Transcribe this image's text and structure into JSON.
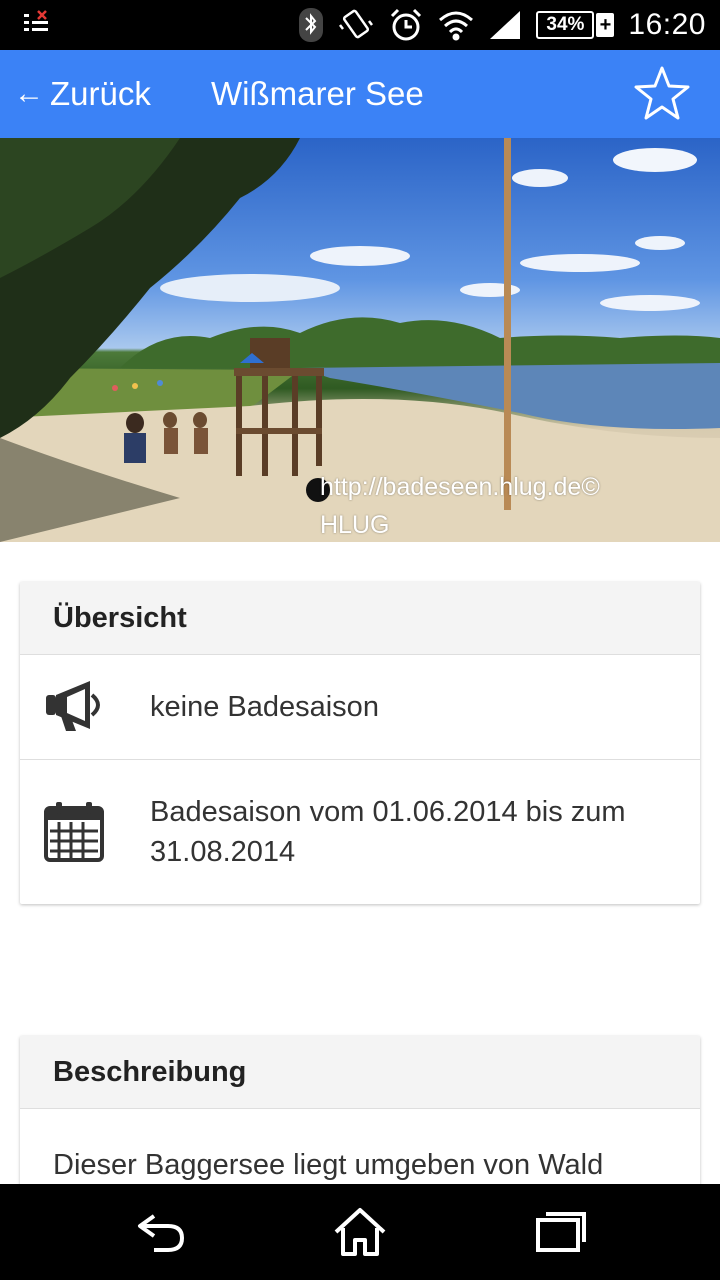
{
  "status_bar": {
    "battery_percent": "34%",
    "battery_plus": "+",
    "time": "16:20"
  },
  "app_bar": {
    "back_label": "Zurück",
    "title": "Wißmarer See",
    "accent_color": "#3b82f6"
  },
  "hero": {
    "caption": "http://badeseen.hlug.de© HLUG"
  },
  "overview": {
    "header": "Übersicht",
    "rows": [
      {
        "icon": "megaphone-icon",
        "text": "keine Badesaison"
      },
      {
        "icon": "calendar-icon",
        "text": "Badesaison vom 01.06.2014 bis zum 31.08.2014"
      }
    ]
  },
  "description": {
    "header": "Beschreibung",
    "text": "Dieser Baggersee liegt umgeben von Wald"
  }
}
